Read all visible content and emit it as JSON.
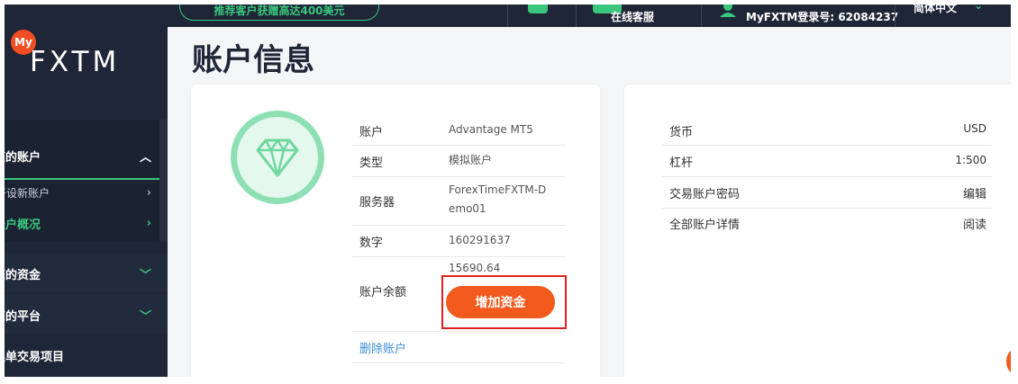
{
  "sidebar": {
    "logo_badge": "My",
    "logo_text": "FXTM",
    "items": [
      {
        "label": "您的账户"
      },
      {
        "label": "开设新账户"
      },
      {
        "label": "账户概况"
      },
      {
        "label": "您的资金"
      },
      {
        "label": "您的平台"
      },
      {
        "label": "跟单交易项目"
      }
    ]
  },
  "topbar": {
    "promo": "推荐客户获赠高达400美元",
    "chat": "在线客服",
    "login": "MyFXTM登录号: 62084237",
    "language": "简体中文"
  },
  "page": {
    "title": "账户信息"
  },
  "account_card": {
    "rows": [
      {
        "label": "账户",
        "value": "Advantage MT5"
      },
      {
        "label": "类型",
        "value": "模拟账户"
      },
      {
        "label": "服务器",
        "value": "ForexTimeFXTM-Demo01"
      },
      {
        "label": "数字",
        "value": "160291637"
      },
      {
        "label": "账户余额",
        "value": "15690.64"
      }
    ],
    "add_funds": "增加资金",
    "delete": "删除账户"
  },
  "details_card": {
    "rows": [
      {
        "label": "货币",
        "value": "USD"
      },
      {
        "label": "杠杆",
        "value": "1:500"
      },
      {
        "label": "交易账户密码",
        "value": "编辑"
      },
      {
        "label": "全部账户详情",
        "value": "阅读"
      }
    ]
  },
  "colors": {
    "accent": "#3ac77d",
    "brand": "#f25a1e",
    "sidebar": "#1e2637",
    "link": "#3d8fd8"
  }
}
